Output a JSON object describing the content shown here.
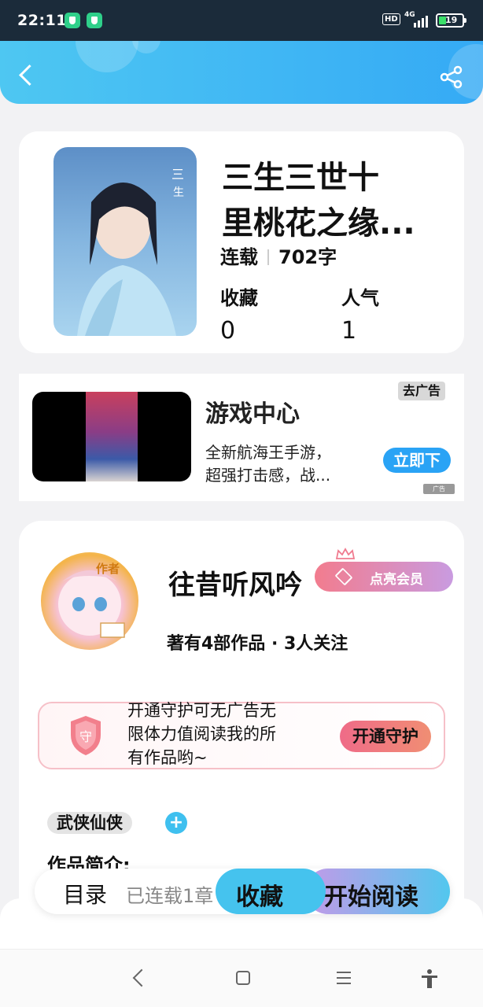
{
  "status_bar": {
    "time": "22:11",
    "hd": "HD",
    "network": "4G",
    "battery": "19"
  },
  "book": {
    "title_line1": "三生三世十",
    "title_line2": "里桃花之缘...",
    "status": "连载",
    "word_count": "702字",
    "collect_label": "收藏",
    "collect_value": "0",
    "popularity_label": "人气",
    "popularity_value": "1"
  },
  "ad": {
    "title": "游戏中心",
    "desc_line1": "全新航海王手游，",
    "desc_line2": "超强打击感，战...",
    "close_label": "去广告",
    "download_label": "立即下",
    "badge": "广告"
  },
  "author": {
    "avatar_tag": "作者",
    "name": "往昔听风吟",
    "vip_label": "点亮会员",
    "meta": "著有4部作品 · 3人关注",
    "guard_line1": "开通守护可无广告无",
    "guard_line2": "限体力值阅读我的所",
    "guard_line3": "有作品哟~",
    "guard_button": "开通守护",
    "guard_icon_char": "守",
    "tag": "武侠仙侠",
    "tag_add": "+",
    "intro_label": "作品简介:"
  },
  "bottom_bar": {
    "toc_label": "目录",
    "progress_label": "已连载1章",
    "collect_button": "收藏",
    "read_button": "开始阅读"
  },
  "colors": {
    "accent": "#35aaf5",
    "vip_start": "#f27c8e",
    "vip_end": "#c99be0",
    "guard": "#ef6b88"
  }
}
